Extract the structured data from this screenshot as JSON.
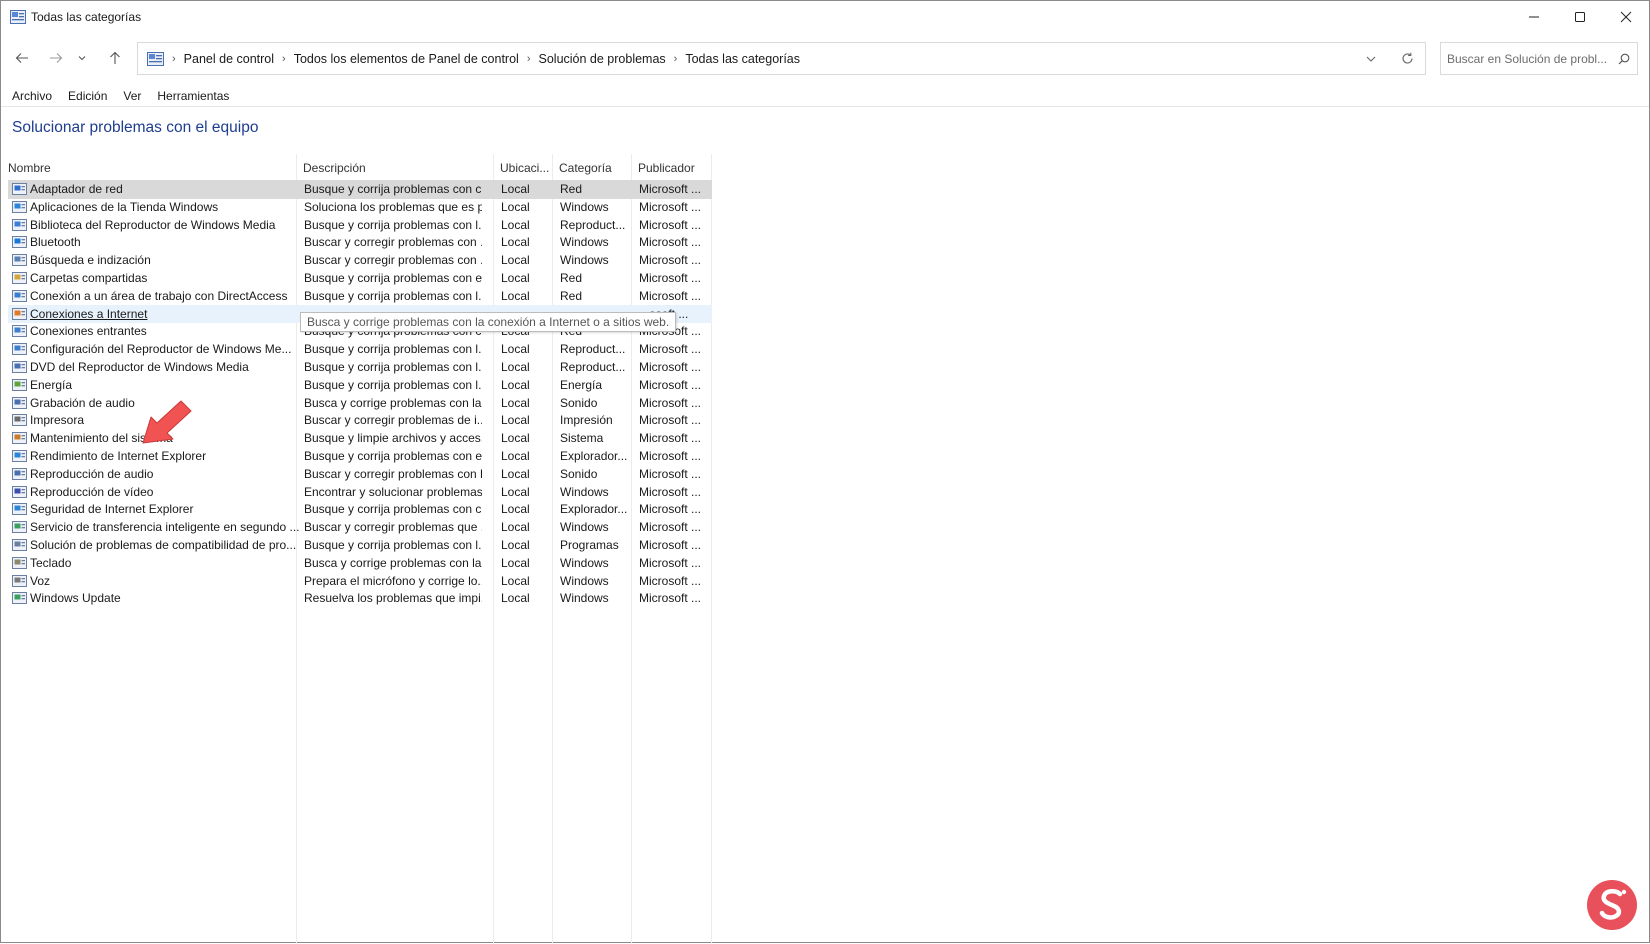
{
  "window": {
    "title": "Todas las categorías"
  },
  "address": {
    "breadcrumbs": [
      "Panel de control",
      "Todos los elementos de Panel de control",
      "Solución de problemas",
      "Todas las categorías"
    ]
  },
  "search": {
    "placeholder": "Buscar en Solución de probl..."
  },
  "menu": {
    "items": [
      "Archivo",
      "Edición",
      "Ver",
      "Herramientas"
    ]
  },
  "page": {
    "title": "Solucionar problemas con el equipo"
  },
  "table": {
    "columns": [
      "Nombre",
      "Descripción",
      "Ubicaci...",
      "Categoría",
      "Publicador"
    ],
    "rows": [
      {
        "icon": "network-adapter-icon",
        "name": "Adaptador de red",
        "desc": "Busque y corrija problemas con c...",
        "loc": "Local",
        "cat": "Red",
        "pub": "Microsoft ..."
      },
      {
        "icon": "store-apps-icon",
        "name": "Aplicaciones de la Tienda Windows",
        "desc": "Soluciona los problemas que es p...",
        "loc": "Local",
        "cat": "Windows",
        "pub": "Microsoft ..."
      },
      {
        "icon": "media-library-icon",
        "name": "Biblioteca del Reproductor de Windows Media",
        "desc": "Busque y corrija problemas con l...",
        "loc": "Local",
        "cat": "Reproduct...",
        "pub": "Microsoft ..."
      },
      {
        "icon": "bluetooth-icon",
        "name": "Bluetooth",
        "desc": "Buscar y corregir problemas con ...",
        "loc": "Local",
        "cat": "Windows",
        "pub": "Microsoft ..."
      },
      {
        "icon": "search-index-icon",
        "name": "Búsqueda e indización",
        "desc": "Buscar y corregir problemas con ...",
        "loc": "Local",
        "cat": "Windows",
        "pub": "Microsoft ..."
      },
      {
        "icon": "shared-folders-icon",
        "name": "Carpetas compartidas",
        "desc": "Busque y corrija problemas con e...",
        "loc": "Local",
        "cat": "Red",
        "pub": "Microsoft ..."
      },
      {
        "icon": "directaccess-icon",
        "name": "Conexión a un área de trabajo con DirectAccess",
        "desc": "Busque y corrija problemas con l...",
        "loc": "Local",
        "cat": "Red",
        "pub": "Microsoft ..."
      },
      {
        "icon": "internet-connections-icon",
        "name": "Conexiones a Internet",
        "desc": "",
        "loc": "",
        "cat": "",
        "pub": "...osoft ..."
      },
      {
        "icon": "incoming-connections-icon",
        "name": "Conexiones entrantes",
        "desc": "Busque y corrija problemas con c...",
        "loc": "Local",
        "cat": "Red",
        "pub": "Microsoft ..."
      },
      {
        "icon": "media-settings-icon",
        "name": "Configuración del Reproductor de Windows Me...",
        "desc": "Busque y corrija problemas con l...",
        "loc": "Local",
        "cat": "Reproduct...",
        "pub": "Microsoft ..."
      },
      {
        "icon": "dvd-icon",
        "name": "DVD del Reproductor de Windows Media",
        "desc": "Busque y corrija problemas con l...",
        "loc": "Local",
        "cat": "Reproduct...",
        "pub": "Microsoft ..."
      },
      {
        "icon": "power-icon",
        "name": "Energía",
        "desc": "Busque y corrija problemas con l...",
        "loc": "Local",
        "cat": "Energía",
        "pub": "Microsoft ..."
      },
      {
        "icon": "audio-recording-icon",
        "name": "Grabación de audio",
        "desc": "Busca y corrige problemas con la ...",
        "loc": "Local",
        "cat": "Sonido",
        "pub": "Microsoft ..."
      },
      {
        "icon": "printer-icon",
        "name": "Impresora",
        "desc": "Buscar y corregir problemas de i...",
        "loc": "Local",
        "cat": "Impresión",
        "pub": "Microsoft ..."
      },
      {
        "icon": "system-maintenance-icon",
        "name": "Mantenimiento del sistema",
        "desc": "Busque y limpie archivos y acces...",
        "loc": "Local",
        "cat": "Sistema",
        "pub": "Microsoft ..."
      },
      {
        "icon": "ie-performance-icon",
        "name": "Rendimiento de Internet Explorer",
        "desc": "Busque y corrija problemas con e...",
        "loc": "Local",
        "cat": "Explorador...",
        "pub": "Microsoft ..."
      },
      {
        "icon": "audio-playback-icon",
        "name": "Reproducción de audio",
        "desc": "Buscar y corregir problemas con l...",
        "loc": "Local",
        "cat": "Sonido",
        "pub": "Microsoft ..."
      },
      {
        "icon": "video-playback-icon",
        "name": "Reproducción de vídeo",
        "desc": "Encontrar y solucionar problemas...",
        "loc": "Local",
        "cat": "Windows",
        "pub": "Microsoft ..."
      },
      {
        "icon": "ie-security-icon",
        "name": "Seguridad de Internet Explorer",
        "desc": "Busque y corrija problemas con c...",
        "loc": "Local",
        "cat": "Explorador...",
        "pub": "Microsoft ..."
      },
      {
        "icon": "bits-icon",
        "name": "Servicio de transferencia inteligente en segundo ...",
        "desc": "Buscar y corregir problemas que ...",
        "loc": "Local",
        "cat": "Windows",
        "pub": "Microsoft ..."
      },
      {
        "icon": "compatibility-icon",
        "name": "Solución de problemas de compatibilidad de pro...",
        "desc": "Busque y corrija problemas con l...",
        "loc": "Local",
        "cat": "Programas",
        "pub": "Microsoft ..."
      },
      {
        "icon": "keyboard-icon",
        "name": "Teclado",
        "desc": "Busca y corrige problemas con la ...",
        "loc": "Local",
        "cat": "Windows",
        "pub": "Microsoft ..."
      },
      {
        "icon": "microphone-icon",
        "name": "Voz",
        "desc": "Prepara el micrófono y corrige lo...",
        "loc": "Local",
        "cat": "Windows",
        "pub": "Microsoft ..."
      },
      {
        "icon": "windows-update-icon",
        "name": "Windows Update",
        "desc": "Resuelva los problemas que impi...",
        "loc": "Local",
        "cat": "Windows",
        "pub": "Microsoft ..."
      }
    ],
    "selected_index": 0,
    "hover_index": 7
  },
  "tooltip": {
    "text": "Busca y corrige problemas con la conexión a Internet o a sitios web."
  },
  "colors": {
    "title_blue": "#1e3d8f",
    "selected_row": "#d9d9d9",
    "hover_row": "#e8f2fc",
    "arrow_red": "#f15252"
  }
}
